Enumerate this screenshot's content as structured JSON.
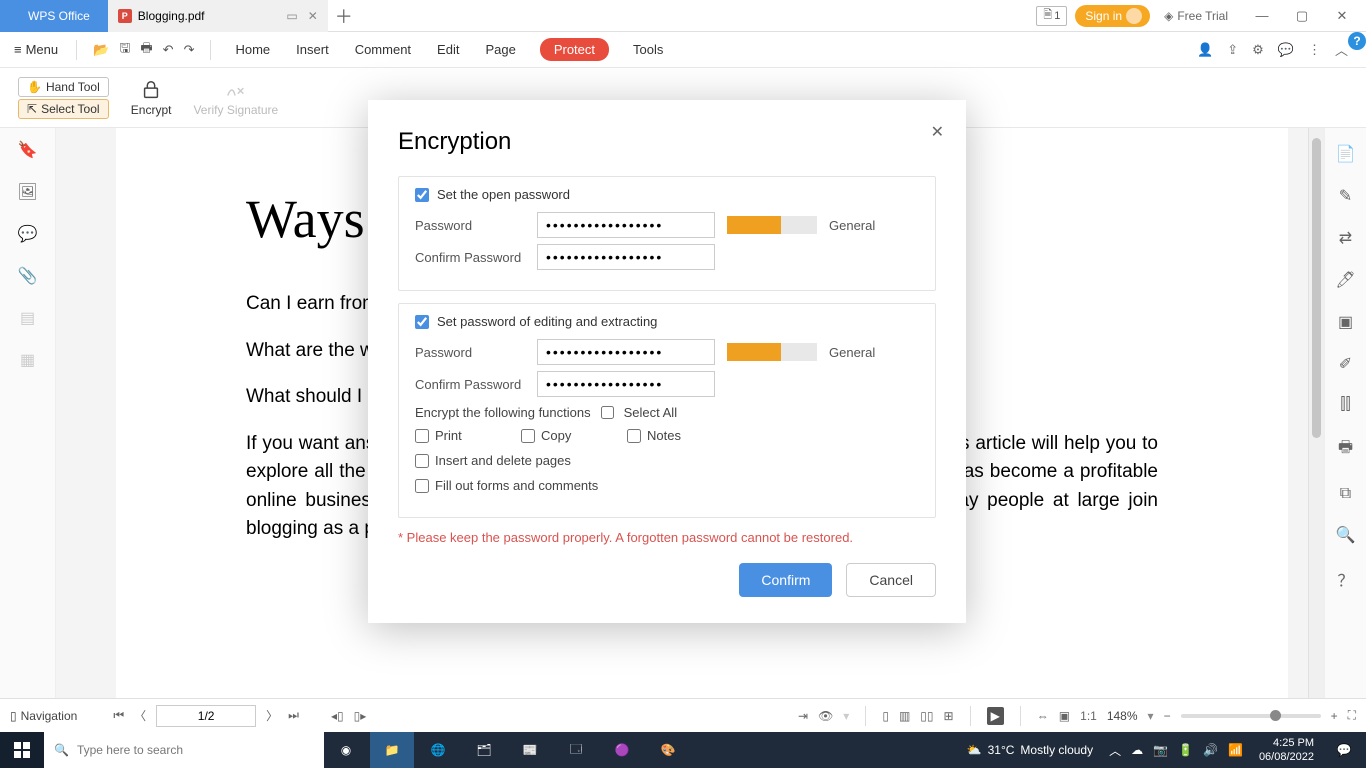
{
  "titlebar": {
    "wps_label": "WPS Office",
    "file_name": "Blogging.pdf",
    "doc_count": "1",
    "signin": "Sign in",
    "free_trial": "Free Trial"
  },
  "menubar": {
    "menu": "Menu",
    "tabs": {
      "home": "Home",
      "insert": "Insert",
      "comment": "Comment",
      "edit": "Edit",
      "page": "Page",
      "protect": "Protect",
      "tools": "Tools"
    }
  },
  "ribbon": {
    "hand_tool": "Hand Tool",
    "select_tool": "Select Tool",
    "encrypt": "Encrypt",
    "verify_signature": "Verify Signature"
  },
  "document": {
    "title": "Ways to",
    "q1": "Can I earn from bl",
    "q2": "What are the way",
    "q3": "What should I blo",
    "para": "If you want answers of any of the above questions then you are at the right spot. This article will help you to explore all the aspects that will help you to get started and be a part of stream that has become a profitable online business unlike few years back when it was just considered a hobby. Today people at large join blogging as a profession to skip the 9-to-5 job."
  },
  "statusbar": {
    "navigation": "Navigation",
    "page": "1/2",
    "zoom_pct": "148%"
  },
  "dialog": {
    "title": "Encryption",
    "section1": {
      "check": "Set the open password",
      "password_label": "Password",
      "confirm_label": "Confirm Password",
      "strength_label": "General",
      "password_value": "•••••••••••••••••",
      "confirm_value": "•••••••••••••••••"
    },
    "section2": {
      "check": "Set password of editing and extracting",
      "password_label": "Password",
      "confirm_label": "Confirm Password",
      "strength_label": "General",
      "password_value": "•••••••••••••••••",
      "confirm_value": "•••••••••••••••••",
      "func_label": "Encrypt the following functions",
      "select_all": "Select All",
      "opts": {
        "print": "Print",
        "copy": "Copy",
        "notes": "Notes",
        "insert_delete": "Insert and delete pages",
        "fill_forms": "Fill out forms and comments"
      }
    },
    "warning": "*  Please keep the password properly. A forgotten password cannot be restored.",
    "confirm_btn": "Confirm",
    "cancel_btn": "Cancel"
  },
  "taskbar": {
    "search_placeholder": "Type here to search",
    "weather_temp": "31°C",
    "weather_desc": "Mostly cloudy",
    "time": "4:25 PM",
    "date": "06/08/2022"
  }
}
